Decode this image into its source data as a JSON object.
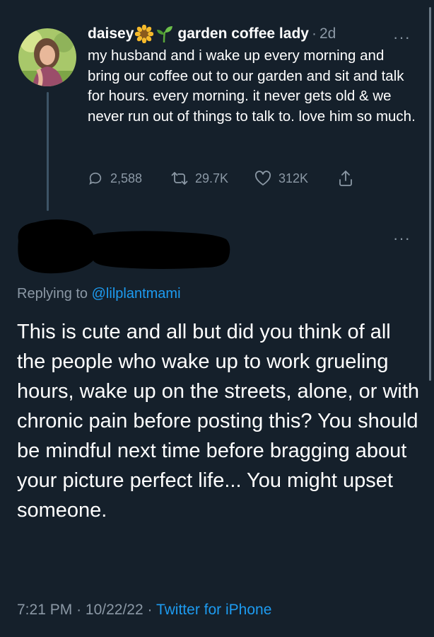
{
  "tweet": {
    "display_name": "daisey",
    "name_suffix": "garden coffee lady",
    "separator": "·",
    "time_ago": "2d",
    "more": "···",
    "text": "my husband and i wake up every morning and bring our coffee out to our garden and sit and talk for hours. every morning. it never gets old & we never run out of things to talk to. love him so much.",
    "reply_count": "2,588",
    "retweet_count": "29.7K",
    "like_count": "312K",
    "icons": [
      "reply-icon",
      "retweet-icon",
      "like-icon",
      "share-icon"
    ]
  },
  "reply": {
    "more": "···",
    "replying_prefix": "Replying to",
    "replying_handle": "@lilplantmami",
    "text": "This is cute and all but did you think of all the people who wake up to work grueling hours, wake up on the streets, alone, or with chronic pain before posting this? You should be mindful next time before bragging about your picture perfect life... You might upset someone.",
    "time": "7:21 PM",
    "date": "10/22/22",
    "separator": "·",
    "source": "Twitter for iPhone"
  },
  "colors": {
    "background": "#15202b",
    "text": "#ffffff",
    "secondary": "#8b98a5",
    "link": "#1d9bf0"
  }
}
